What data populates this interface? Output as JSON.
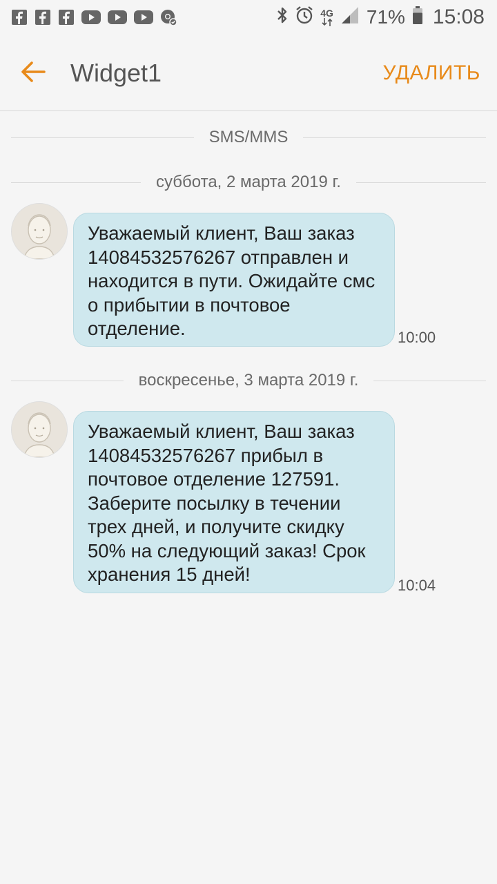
{
  "status_bar": {
    "notification_icons": [
      "facebook-icon",
      "facebook-icon",
      "facebook-icon",
      "youtube-icon",
      "youtube-icon",
      "youtube-icon",
      "chrome-icon"
    ],
    "network": "4G",
    "battery_percent": "71%",
    "time": "15:08"
  },
  "app_bar": {
    "title": "Widget1",
    "delete_label": "УДАЛИТЬ"
  },
  "thread": {
    "channel_label": "SMS/MMS",
    "groups": [
      {
        "date": "суббота, 2 марта 2019 г.",
        "message": "Уважаемый клиент, Ваш заказ 14084532576267 отправлен и находится в пути. Ожидайте смс о прибытии в почтовое отделение.",
        "time": "10:00"
      },
      {
        "date": "воскресенье, 3 марта 2019 г.",
        "message": "Уважаемый клиент, Ваш заказ 14084532576267 прибыл в почтовое отделение 127591. Заберите посылку в течении трех дней, и получите скидку 50% на следующий заказ! Срок хранения 15 дней!",
        "time": "10:04"
      }
    ]
  },
  "colors": {
    "accent": "#e88a1a",
    "bubble": "#cfe8ee",
    "background": "#f5f5f5"
  }
}
